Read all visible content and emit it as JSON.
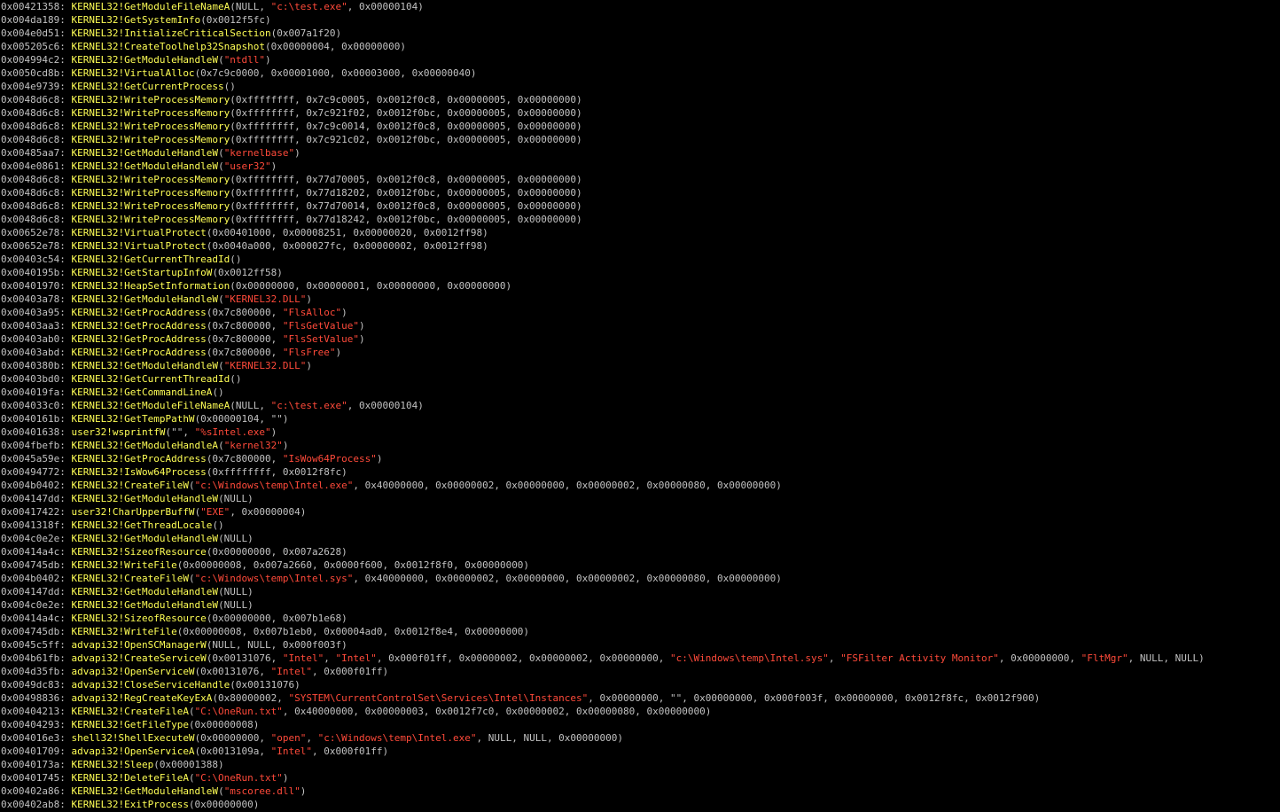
{
  "colors": {
    "background": "#000000",
    "address": "#c2c2c2",
    "function": "#ffff55",
    "string": "#ff4a3a",
    "plain": "#c2c2c2"
  },
  "lines": [
    {
      "addr": "0x00421358:",
      "fn": "KERNEL32!GetModuleFileNameA",
      "args": [
        [
          "p",
          "(NULL, "
        ],
        [
          "s",
          "\"c:\\test.exe\""
        ],
        [
          "p",
          ", 0x00000104)"
        ]
      ]
    },
    {
      "addr": "0x004da189:",
      "fn": "KERNEL32!GetSystemInfo",
      "args": [
        [
          "p",
          "(0x0012f5fc)"
        ]
      ]
    },
    {
      "addr": "0x004e0d51:",
      "fn": "KERNEL32!InitializeCriticalSection",
      "args": [
        [
          "p",
          "(0x007a1f20)"
        ]
      ]
    },
    {
      "addr": "0x005205c6:",
      "fn": "KERNEL32!CreateToolhelp32Snapshot",
      "args": [
        [
          "p",
          "(0x00000004, 0x00000000)"
        ]
      ]
    },
    {
      "addr": "0x004994c2:",
      "fn": "KERNEL32!GetModuleHandleW",
      "args": [
        [
          "p",
          "("
        ],
        [
          "s",
          "\"ntdll\""
        ],
        [
          "p",
          ")"
        ]
      ]
    },
    {
      "addr": "0x0050cd8b:",
      "fn": "KERNEL32!VirtualAlloc",
      "args": [
        [
          "p",
          "(0x7c9c0000, 0x00001000, 0x00003000, 0x00000040)"
        ]
      ]
    },
    {
      "addr": "0x004e9739:",
      "fn": "KERNEL32!GetCurrentProcess",
      "args": [
        [
          "p",
          "()"
        ]
      ]
    },
    {
      "addr": "0x0048d6c8:",
      "fn": "KERNEL32!WriteProcessMemory",
      "args": [
        [
          "p",
          "(0xffffffff, 0x7c9c0005, 0x0012f0c8, 0x00000005, 0x00000000)"
        ]
      ]
    },
    {
      "addr": "0x0048d6c8:",
      "fn": "KERNEL32!WriteProcessMemory",
      "args": [
        [
          "p",
          "(0xffffffff, 0x7c921f02, 0x0012f0bc, 0x00000005, 0x00000000)"
        ]
      ]
    },
    {
      "addr": "0x0048d6c8:",
      "fn": "KERNEL32!WriteProcessMemory",
      "args": [
        [
          "p",
          "(0xffffffff, 0x7c9c0014, 0x0012f0c8, 0x00000005, 0x00000000)"
        ]
      ]
    },
    {
      "addr": "0x0048d6c8:",
      "fn": "KERNEL32!WriteProcessMemory",
      "args": [
        [
          "p",
          "(0xffffffff, 0x7c921c02, 0x0012f0bc, 0x00000005, 0x00000000)"
        ]
      ]
    },
    {
      "addr": "0x00485aa7:",
      "fn": "KERNEL32!GetModuleHandleW",
      "args": [
        [
          "p",
          "("
        ],
        [
          "s",
          "\"kernelbase\""
        ],
        [
          "p",
          ")"
        ]
      ]
    },
    {
      "addr": "0x004e0861:",
      "fn": "KERNEL32!GetModuleHandleW",
      "args": [
        [
          "p",
          "("
        ],
        [
          "s",
          "\"user32\""
        ],
        [
          "p",
          ")"
        ]
      ]
    },
    {
      "addr": "0x0048d6c8:",
      "fn": "KERNEL32!WriteProcessMemory",
      "args": [
        [
          "p",
          "(0xffffffff, 0x77d70005, 0x0012f0c8, 0x00000005, 0x00000000)"
        ]
      ]
    },
    {
      "addr": "0x0048d6c8:",
      "fn": "KERNEL32!WriteProcessMemory",
      "args": [
        [
          "p",
          "(0xffffffff, 0x77d18202, 0x0012f0bc, 0x00000005, 0x00000000)"
        ]
      ]
    },
    {
      "addr": "0x0048d6c8:",
      "fn": "KERNEL32!WriteProcessMemory",
      "args": [
        [
          "p",
          "(0xffffffff, 0x77d70014, 0x0012f0c8, 0x00000005, 0x00000000)"
        ]
      ]
    },
    {
      "addr": "0x0048d6c8:",
      "fn": "KERNEL32!WriteProcessMemory",
      "args": [
        [
          "p",
          "(0xffffffff, 0x77d18242, 0x0012f0bc, 0x00000005, 0x00000000)"
        ]
      ]
    },
    {
      "addr": "0x00652e78:",
      "fn": "KERNEL32!VirtualProtect",
      "args": [
        [
          "p",
          "(0x00401000, 0x00008251, 0x00000020, 0x0012ff98)"
        ]
      ]
    },
    {
      "addr": "0x00652e78:",
      "fn": "KERNEL32!VirtualProtect",
      "args": [
        [
          "p",
          "(0x0040a000, 0x000027fc, 0x00000002, 0x0012ff98)"
        ]
      ]
    },
    {
      "addr": "0x00403c54:",
      "fn": "KERNEL32!GetCurrentThreadId",
      "args": [
        [
          "p",
          "()"
        ]
      ]
    },
    {
      "addr": "0x0040195b:",
      "fn": "KERNEL32!GetStartupInfoW",
      "args": [
        [
          "p",
          "(0x0012ff58)"
        ]
      ]
    },
    {
      "addr": "0x00401970:",
      "fn": "KERNEL32!HeapSetInformation",
      "args": [
        [
          "p",
          "(0x00000000, 0x00000001, 0x00000000, 0x00000000)"
        ]
      ]
    },
    {
      "addr": "0x00403a78:",
      "fn": "KERNEL32!GetModuleHandleW",
      "args": [
        [
          "p",
          "("
        ],
        [
          "s",
          "\"KERNEL32.DLL\""
        ],
        [
          "p",
          ")"
        ]
      ]
    },
    {
      "addr": "0x00403a95:",
      "fn": "KERNEL32!GetProcAddress",
      "args": [
        [
          "p",
          "(0x7c800000, "
        ],
        [
          "s",
          "\"FlsAlloc\""
        ],
        [
          "p",
          ")"
        ]
      ]
    },
    {
      "addr": "0x00403aa3:",
      "fn": "KERNEL32!GetProcAddress",
      "args": [
        [
          "p",
          "(0x7c800000, "
        ],
        [
          "s",
          "\"FlsGetValue\""
        ],
        [
          "p",
          ")"
        ]
      ]
    },
    {
      "addr": "0x00403ab0:",
      "fn": "KERNEL32!GetProcAddress",
      "args": [
        [
          "p",
          "(0x7c800000, "
        ],
        [
          "s",
          "\"FlsSetValue\""
        ],
        [
          "p",
          ")"
        ]
      ]
    },
    {
      "addr": "0x00403abd:",
      "fn": "KERNEL32!GetProcAddress",
      "args": [
        [
          "p",
          "(0x7c800000, "
        ],
        [
          "s",
          "\"FlsFree\""
        ],
        [
          "p",
          ")"
        ]
      ]
    },
    {
      "addr": "0x0040380b:",
      "fn": "KERNEL32!GetModuleHandleW",
      "args": [
        [
          "p",
          "("
        ],
        [
          "s",
          "\"KERNEL32.DLL\""
        ],
        [
          "p",
          ")"
        ]
      ]
    },
    {
      "addr": "0x00403bd0:",
      "fn": "KERNEL32!GetCurrentThreadId",
      "args": [
        [
          "p",
          "()"
        ]
      ]
    },
    {
      "addr": "0x004019fa:",
      "fn": "KERNEL32!GetCommandLineA",
      "args": [
        [
          "p",
          "()"
        ]
      ]
    },
    {
      "addr": "0x004033c0:",
      "fn": "KERNEL32!GetModuleFileNameA",
      "args": [
        [
          "p",
          "(NULL, "
        ],
        [
          "s",
          "\"c:\\test.exe\""
        ],
        [
          "p",
          ", 0x00000104)"
        ]
      ]
    },
    {
      "addr": "0x0040161b:",
      "fn": "KERNEL32!GetTempPathW",
      "args": [
        [
          "p",
          "(0x00000104, \"\")"
        ]
      ]
    },
    {
      "addr": "0x00401638:",
      "fn": "user32!wsprintfW",
      "args": [
        [
          "p",
          "(\"\", "
        ],
        [
          "s",
          "\"%sIntel.exe\""
        ],
        [
          "p",
          ")"
        ]
      ]
    },
    {
      "addr": "0x004fbefb:",
      "fn": "KERNEL32!GetModuleHandleA",
      "args": [
        [
          "p",
          "("
        ],
        [
          "s",
          "\"kernel32\""
        ],
        [
          "p",
          ")"
        ]
      ]
    },
    {
      "addr": "0x0045a59e:",
      "fn": "KERNEL32!GetProcAddress",
      "args": [
        [
          "p",
          "(0x7c800000, "
        ],
        [
          "s",
          "\"IsWow64Process\""
        ],
        [
          "p",
          ")"
        ]
      ]
    },
    {
      "addr": "0x00494772:",
      "fn": "KERNEL32!IsWow64Process",
      "args": [
        [
          "p",
          "(0xffffffff, 0x0012f8fc)"
        ]
      ]
    },
    {
      "addr": "0x004b0402:",
      "fn": "KERNEL32!CreateFileW",
      "args": [
        [
          "p",
          "("
        ],
        [
          "s",
          "\"c:\\Windows\\temp\\Intel.exe\""
        ],
        [
          "p",
          ", 0x40000000, 0x00000002, 0x00000000, 0x00000002, 0x00000080, 0x00000000)"
        ]
      ]
    },
    {
      "addr": "0x004147dd:",
      "fn": "KERNEL32!GetModuleHandleW",
      "args": [
        [
          "p",
          "(NULL)"
        ]
      ]
    },
    {
      "addr": "0x00417422:",
      "fn": "user32!CharUpperBuffW",
      "args": [
        [
          "p",
          "("
        ],
        [
          "s",
          "\"EXE\""
        ],
        [
          "p",
          ", 0x00000004)"
        ]
      ]
    },
    {
      "addr": "0x0041318f:",
      "fn": "KERNEL32!GetThreadLocale",
      "args": [
        [
          "p",
          "()"
        ]
      ]
    },
    {
      "addr": "0x004c0e2e:",
      "fn": "KERNEL32!GetModuleHandleW",
      "args": [
        [
          "p",
          "(NULL)"
        ]
      ]
    },
    {
      "addr": "0x00414a4c:",
      "fn": "KERNEL32!SizeofResource",
      "args": [
        [
          "p",
          "(0x00000000, 0x007a2628)"
        ]
      ]
    },
    {
      "addr": "0x004745db:",
      "fn": "KERNEL32!WriteFile",
      "args": [
        [
          "p",
          "(0x00000008, 0x007a2660, 0x0000f600, 0x0012f8f0, 0x00000000)"
        ]
      ]
    },
    {
      "addr": "0x004b0402:",
      "fn": "KERNEL32!CreateFileW",
      "args": [
        [
          "p",
          "("
        ],
        [
          "s",
          "\"c:\\Windows\\temp\\Intel.sys\""
        ],
        [
          "p",
          ", 0x40000000, 0x00000002, 0x00000000, 0x00000002, 0x00000080, 0x00000000)"
        ]
      ]
    },
    {
      "addr": "0x004147dd:",
      "fn": "KERNEL32!GetModuleHandleW",
      "args": [
        [
          "p",
          "(NULL)"
        ]
      ]
    },
    {
      "addr": "0x004c0e2e:",
      "fn": "KERNEL32!GetModuleHandleW",
      "args": [
        [
          "p",
          "(NULL)"
        ]
      ]
    },
    {
      "addr": "0x00414a4c:",
      "fn": "KERNEL32!SizeofResource",
      "args": [
        [
          "p",
          "(0x00000000, 0x007b1e68)"
        ]
      ]
    },
    {
      "addr": "0x004745db:",
      "fn": "KERNEL32!WriteFile",
      "args": [
        [
          "p",
          "(0x00000008, 0x007b1eb0, 0x00004ad0, 0x0012f8e4, 0x00000000)"
        ]
      ]
    },
    {
      "addr": "0x0045c5ff:",
      "fn": "advapi32!OpenSCManagerW",
      "args": [
        [
          "p",
          "(NULL, NULL, 0x000f003f)"
        ]
      ]
    },
    {
      "addr": "0x004b61fb:",
      "fn": "advapi32!CreateServiceW",
      "args": [
        [
          "p",
          "(0x00131076, "
        ],
        [
          "s",
          "\"Intel\""
        ],
        [
          "p",
          ", "
        ],
        [
          "s",
          "\"Intel\""
        ],
        [
          "p",
          ", 0x000f01ff, 0x00000002, 0x00000002, 0x00000000, "
        ],
        [
          "s",
          "\"c:\\Windows\\temp\\Intel.sys\""
        ],
        [
          "p",
          ", "
        ],
        [
          "s",
          "\"FSFilter Activity Monitor\""
        ],
        [
          "p",
          ", 0x00000000, "
        ],
        [
          "s",
          "\"FltMgr\""
        ],
        [
          "p",
          ", NULL, NULL)"
        ]
      ]
    },
    {
      "addr": "0x004d35fb:",
      "fn": "advapi32!OpenServiceW",
      "args": [
        [
          "p",
          "(0x00131076, "
        ],
        [
          "s",
          "\"Intel\""
        ],
        [
          "p",
          ", 0x000f01ff)"
        ]
      ]
    },
    {
      "addr": "0x0049dc83:",
      "fn": "advapi32!CloseServiceHandle",
      "args": [
        [
          "p",
          "(0x00131076)"
        ]
      ]
    },
    {
      "addr": "0x00498836:",
      "fn": "advapi32!RegCreateKeyExA",
      "args": [
        [
          "p",
          "(0x80000002, "
        ],
        [
          "s",
          "\"SYSTEM\\CurrentControlSet\\Services\\Intel\\Instances\""
        ],
        [
          "p",
          ", 0x00000000, \"\", 0x00000000, 0x000f003f, 0x00000000, 0x0012f8fc, 0x0012f900)"
        ]
      ]
    },
    {
      "addr": "0x00404213:",
      "fn": "KERNEL32!CreateFileA",
      "args": [
        [
          "p",
          "("
        ],
        [
          "s",
          "\"C:\\OneRun.txt\""
        ],
        [
          "p",
          ", 0x40000000, 0x00000003, 0x0012f7c0, 0x00000002, 0x00000080, 0x00000000)"
        ]
      ]
    },
    {
      "addr": "0x00404293:",
      "fn": "KERNEL32!GetFileType",
      "args": [
        [
          "p",
          "(0x00000008)"
        ]
      ]
    },
    {
      "addr": "0x004016e3:",
      "fn": "shell32!ShellExecuteW",
      "args": [
        [
          "p",
          "(0x00000000, "
        ],
        [
          "s",
          "\"open\""
        ],
        [
          "p",
          ", "
        ],
        [
          "s",
          "\"c:\\Windows\\temp\\Intel.exe\""
        ],
        [
          "p",
          ", NULL, NULL, 0x00000000)"
        ]
      ]
    },
    {
      "addr": "0x00401709:",
      "fn": "advapi32!OpenServiceA",
      "args": [
        [
          "p",
          "(0x0013109a, "
        ],
        [
          "s",
          "\"Intel\""
        ],
        [
          "p",
          ", 0x000f01ff)"
        ]
      ]
    },
    {
      "addr": "0x0040173a:",
      "fn": "KERNEL32!Sleep",
      "args": [
        [
          "p",
          "(0x00001388)"
        ]
      ]
    },
    {
      "addr": "0x00401745:",
      "fn": "KERNEL32!DeleteFileA",
      "args": [
        [
          "p",
          "("
        ],
        [
          "s",
          "\"C:\\OneRun.txt\""
        ],
        [
          "p",
          ")"
        ]
      ]
    },
    {
      "addr": "0x00402a86:",
      "fn": "KERNEL32!GetModuleHandleW",
      "args": [
        [
          "p",
          "("
        ],
        [
          "s",
          "\"mscoree.dll\""
        ],
        [
          "p",
          ")"
        ]
      ]
    },
    {
      "addr": "0x00402ab8:",
      "fn": "KERNEL32!ExitProcess",
      "args": [
        [
          "p",
          "(0x00000000)"
        ]
      ]
    }
  ]
}
